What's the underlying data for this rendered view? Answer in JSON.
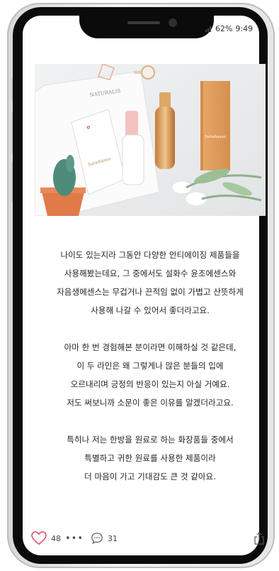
{
  "status": {
    "signal_label": "..ıl",
    "battery": "62%",
    "time": "9:49"
  },
  "photo": {
    "product_brand_left": "NATURALIS",
    "product_brand": "Sulwhasoo",
    "box_brand": "Sulwhasoo"
  },
  "post": {
    "paragraphs": [
      [
        "나이도 있는지라 그동안 다양한 안티에이징 제품들을",
        "사용해봤는데요, 그 중에서도 설화수 윤조에센스와",
        "자음생에센스는 무겁거나 끈적임 없이 가볍고 산뜻하게",
        "사용해 나갈 수 있어서 좋더라고요."
      ],
      [
        "아마 한 번 경험해본 분이라면 이해하실 것 같은데,",
        "이 두 라인은 왜 그렇게나 많은 분들의 입에",
        "오르내리며 긍정의 반응이 있는지 아실 거예요.",
        "저도 써보니까 소문이 좋은 이유를 알겠더라고요."
      ],
      [
        "특히나 저는 한방을 원료로 하는 화장품들 중에서",
        "특별하고 귀한 원료를 사용한 제품이라",
        "더 마음이 가고 기대감도 큰 것 같아요."
      ]
    ]
  },
  "actions": {
    "likes": "48",
    "more": "•••",
    "comments": "31"
  },
  "colors": {
    "heart": "#e0566a",
    "box_gold": "#e3a263"
  }
}
